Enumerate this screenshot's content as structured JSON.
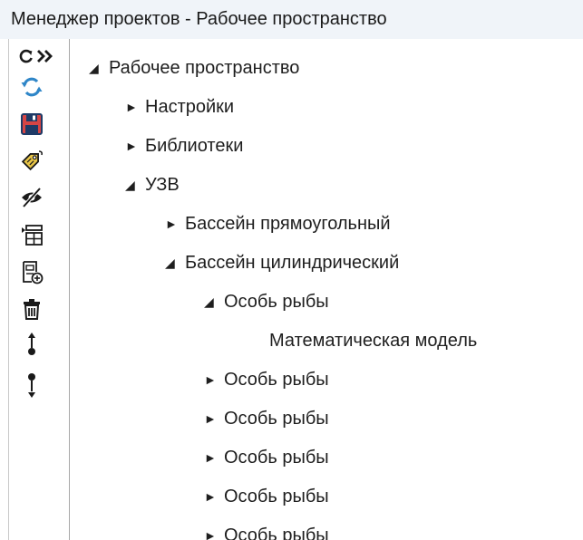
{
  "window": {
    "title": "Менеджер проектов - Рабочее пространство"
  },
  "toolbar": {
    "items": [
      {
        "icon": "refresh-icon"
      },
      {
        "icon": "expand-all-icon"
      },
      {
        "icon": "sync-arrows-icon"
      },
      {
        "icon": "save-floppy-icon"
      },
      {
        "icon": "tag-label-icon"
      },
      {
        "icon": "hide-eye-icon"
      },
      {
        "icon": "add-table-icon"
      },
      {
        "icon": "add-document-icon"
      },
      {
        "icon": "delete-trash-icon"
      },
      {
        "icon": "move-up-icon"
      },
      {
        "icon": "move-down-icon"
      }
    ]
  },
  "tree": {
    "expanded_glyph": "◢",
    "collapsed_glyph": "►",
    "nodes": [
      {
        "label": "Рабочее пространство",
        "state": "expanded"
      },
      {
        "label": "Настройки",
        "state": "collapsed"
      },
      {
        "label": "Библиотеки",
        "state": "collapsed"
      },
      {
        "label": "УЗВ",
        "state": "expanded"
      },
      {
        "label": "Бассейн прямоугольный",
        "state": "collapsed"
      },
      {
        "label": "Бассейн цилиндрический",
        "state": "expanded"
      },
      {
        "label": "Особь рыбы",
        "state": "expanded"
      },
      {
        "label": "Математическая модель",
        "state": "leaf"
      },
      {
        "label": "Особь рыбы",
        "state": "collapsed"
      },
      {
        "label": "Особь рыбы",
        "state": "collapsed"
      },
      {
        "label": "Особь рыбы",
        "state": "collapsed"
      },
      {
        "label": "Особь рыбы",
        "state": "collapsed"
      },
      {
        "label": "Особь рыбы",
        "state": "collapsed"
      }
    ]
  }
}
